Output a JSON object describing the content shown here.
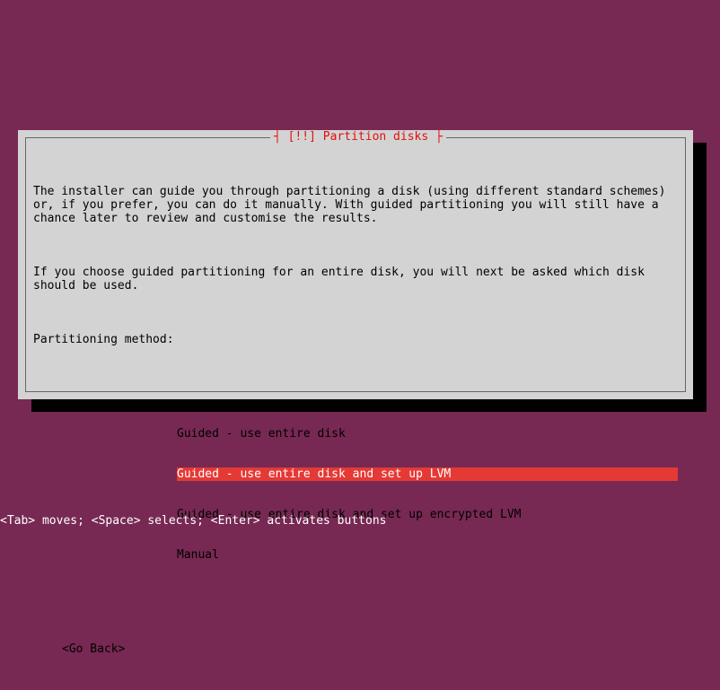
{
  "dialog": {
    "title": "[!!] Partition disks",
    "para1": "The installer can guide you through partitioning a disk (using different standard schemes) or, if you prefer, you can do it manually. With guided partitioning you will still have a chance later to review and customise the results.",
    "para2": "If you choose guided partitioning for an entire disk, you will next be asked which disk should be used.",
    "prompt": "Partitioning method:",
    "options": [
      "Guided - use entire disk",
      "Guided - use entire disk and set up LVM",
      "Guided - use entire disk and set up encrypted LVM",
      "Manual"
    ],
    "selected_index": 1,
    "go_back": "<Go Back>"
  },
  "footer": "<Tab> moves; <Space> selects; <Enter> activates buttons"
}
